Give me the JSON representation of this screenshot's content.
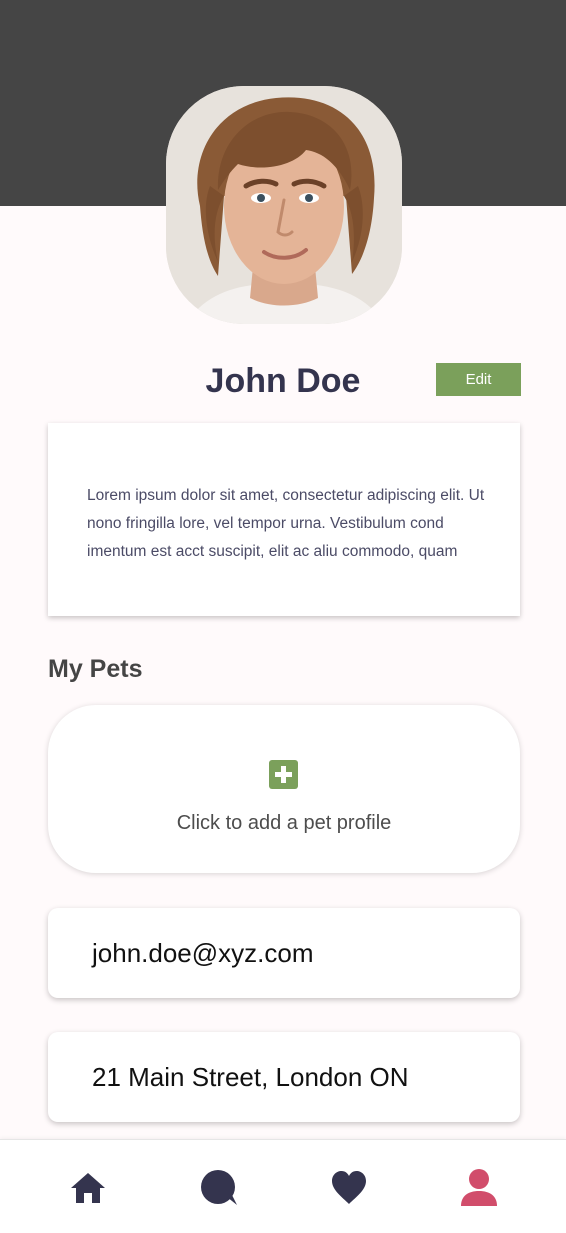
{
  "profile": {
    "name": "John Doe",
    "edit_label": "Edit",
    "bio": "Lorem ipsum dolor sit amet, consectetur adipiscing elit. Ut nono fringilla lore, vel tempor urna. Vestibulum cond imentum est acct suscipit, elit ac aliu commodo, quam"
  },
  "pets": {
    "title": "My Pets",
    "add_label": "Click to add a pet profile"
  },
  "contact": {
    "email": "john.doe@xyz.com",
    "address": "21 Main Street, London ON"
  },
  "nav": {
    "items": [
      {
        "icon": "home-icon",
        "active": false
      },
      {
        "icon": "chat-icon",
        "active": false
      },
      {
        "icon": "heart-icon",
        "active": false
      },
      {
        "icon": "user-icon",
        "active": true
      }
    ]
  },
  "colors": {
    "header": "#454545",
    "accent": "#7ba05b",
    "nav_icon": "#34344e",
    "nav_active": "#d14d6b",
    "name_text": "#34344e"
  }
}
